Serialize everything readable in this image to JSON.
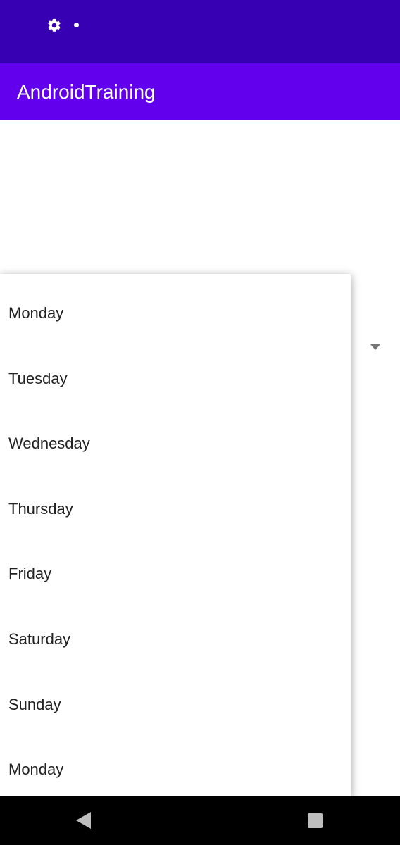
{
  "status_bar": {
    "icons": [
      "gear-icon",
      "dot-icon"
    ],
    "color": "#3700B3"
  },
  "app_bar": {
    "title": "AndroidTraining",
    "color": "#6200EE"
  },
  "spinner": {
    "icon": "dropdown-arrow-icon",
    "options": [
      "Monday",
      "Tuesday",
      "Wednesday",
      "Thursday",
      "Friday",
      "Saturday",
      "Sunday",
      "Monday"
    ]
  },
  "nav_bar": {
    "icons": [
      "back-icon",
      "recents-icon"
    ]
  }
}
